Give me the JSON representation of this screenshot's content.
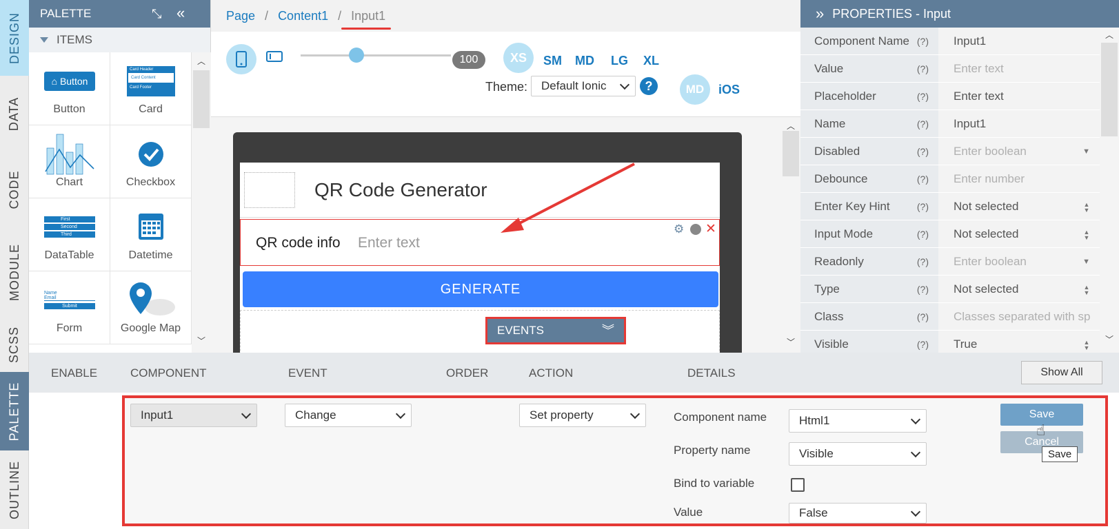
{
  "side_tabs": [
    "DESIGN",
    "DATA",
    "CODE",
    "MODULE",
    "SCSS",
    "PALETTE",
    "OUTLINE"
  ],
  "palette": {
    "title": "PALETTE",
    "section": "ITEMS",
    "items": [
      {
        "label": "Button",
        "icon": "button-icon"
      },
      {
        "label": "Card",
        "icon": "card-icon"
      },
      {
        "label": "Chart",
        "icon": "chart-icon"
      },
      {
        "label": "Checkbox",
        "icon": "checkbox-icon"
      },
      {
        "label": "DataTable",
        "icon": "datatable-icon"
      },
      {
        "label": "Datetime",
        "icon": "calendar-icon"
      },
      {
        "label": "Form",
        "icon": "form-icon"
      },
      {
        "label": "Google Map",
        "icon": "map-pin-icon"
      }
    ],
    "button_preview": "Button",
    "card_preview": [
      "Card Header",
      "Card Content",
      "Card Footer"
    ],
    "table_preview": [
      "First",
      "Second",
      "Third"
    ],
    "form_preview": [
      "Name",
      "Email",
      "Submit"
    ]
  },
  "breadcrumb": {
    "items": [
      "Page",
      "Content1"
    ],
    "current": "Input1",
    "sep": "/"
  },
  "toolbar": {
    "zoom": "100",
    "breakpoints": [
      "XS",
      "SM",
      "MD",
      "LG",
      "XL"
    ],
    "theme_label": "Theme:",
    "theme_value": "Default Ionic",
    "platforms": [
      "MD",
      "iOS"
    ],
    "help": "?"
  },
  "device": {
    "header_title": "QR Code Generator",
    "input_label": "QR code info",
    "input_placeholder": "Enter text",
    "button_label": "GENERATE",
    "events_label": "EVENTS"
  },
  "properties": {
    "title": "PROPERTIES - Input",
    "rows": [
      {
        "name": "Component Name",
        "value": "Input1",
        "placeholder": false,
        "dropdown": ""
      },
      {
        "name": "Value",
        "value": "Enter text",
        "placeholder": true,
        "dropdown": ""
      },
      {
        "name": "Placeholder",
        "value": "Enter text",
        "placeholder": false,
        "dropdown": ""
      },
      {
        "name": "Name",
        "value": "Input1",
        "placeholder": false,
        "dropdown": ""
      },
      {
        "name": "Disabled",
        "value": "Enter boolean",
        "placeholder": true,
        "dropdown": "▼"
      },
      {
        "name": "Debounce",
        "value": "Enter number",
        "placeholder": true,
        "dropdown": ""
      },
      {
        "name": "Enter Key Hint",
        "value": "Not selected",
        "placeholder": false,
        "dropdown": "▲▼"
      },
      {
        "name": "Input Mode",
        "value": "Not selected",
        "placeholder": false,
        "dropdown": "▲▼"
      },
      {
        "name": "Readonly",
        "value": "Enter boolean",
        "placeholder": true,
        "dropdown": "▼"
      },
      {
        "name": "Type",
        "value": "Not selected",
        "placeholder": false,
        "dropdown": "▲▼"
      },
      {
        "name": "Class",
        "value": "Classes separated with sp",
        "placeholder": true,
        "dropdown": ""
      },
      {
        "name": "Visible",
        "value": "True",
        "placeholder": false,
        "dropdown": "▲▼"
      }
    ],
    "help": "(?)"
  },
  "events": {
    "columns": [
      "ENABLE",
      "COMPONENT",
      "EVENT",
      "ORDER",
      "ACTION",
      "DETAILS"
    ],
    "show_all": "Show All",
    "component": "Input1",
    "event": "Change",
    "action": "Set property",
    "details": [
      {
        "label": "Component name",
        "value": "Html1"
      },
      {
        "label": "Property name",
        "value": "Visible"
      },
      {
        "label": "Bind to variable",
        "value": ""
      },
      {
        "label": "Value",
        "value": "False"
      }
    ],
    "save": "Save",
    "cancel": "Cancel",
    "tooltip": "Save"
  }
}
